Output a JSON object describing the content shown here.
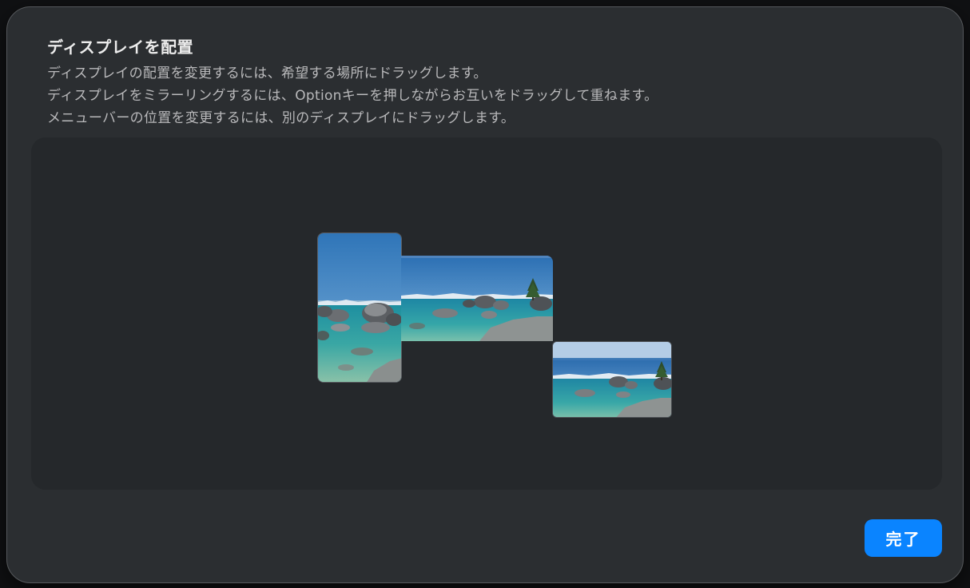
{
  "dialog": {
    "title": "ディスプレイを配置",
    "description": [
      "ディスプレイの配置を変更するには、希望する場所にドラッグします。",
      "ディスプレイをミラーリングするには、Optionキーを押しながらお互いをドラッグして重ねます。",
      "メニューバーの位置を変更するには、別のディスプレイにドラッグします。"
    ],
    "done_label": "完了"
  },
  "displays": [
    {
      "orientation": "portrait",
      "wallpaper": "lake-shore-rocks",
      "menu_bar": false
    },
    {
      "orientation": "landscape",
      "wallpaper": "lake-shore-rocks",
      "menu_bar": true
    },
    {
      "orientation": "landscape",
      "wallpaper": "lake-shore-rocks",
      "menu_bar": false
    }
  ],
  "colors": {
    "accent": "#0a84ff",
    "sheet_background": "#2b2e31",
    "arrangement_area": "#25282b"
  }
}
